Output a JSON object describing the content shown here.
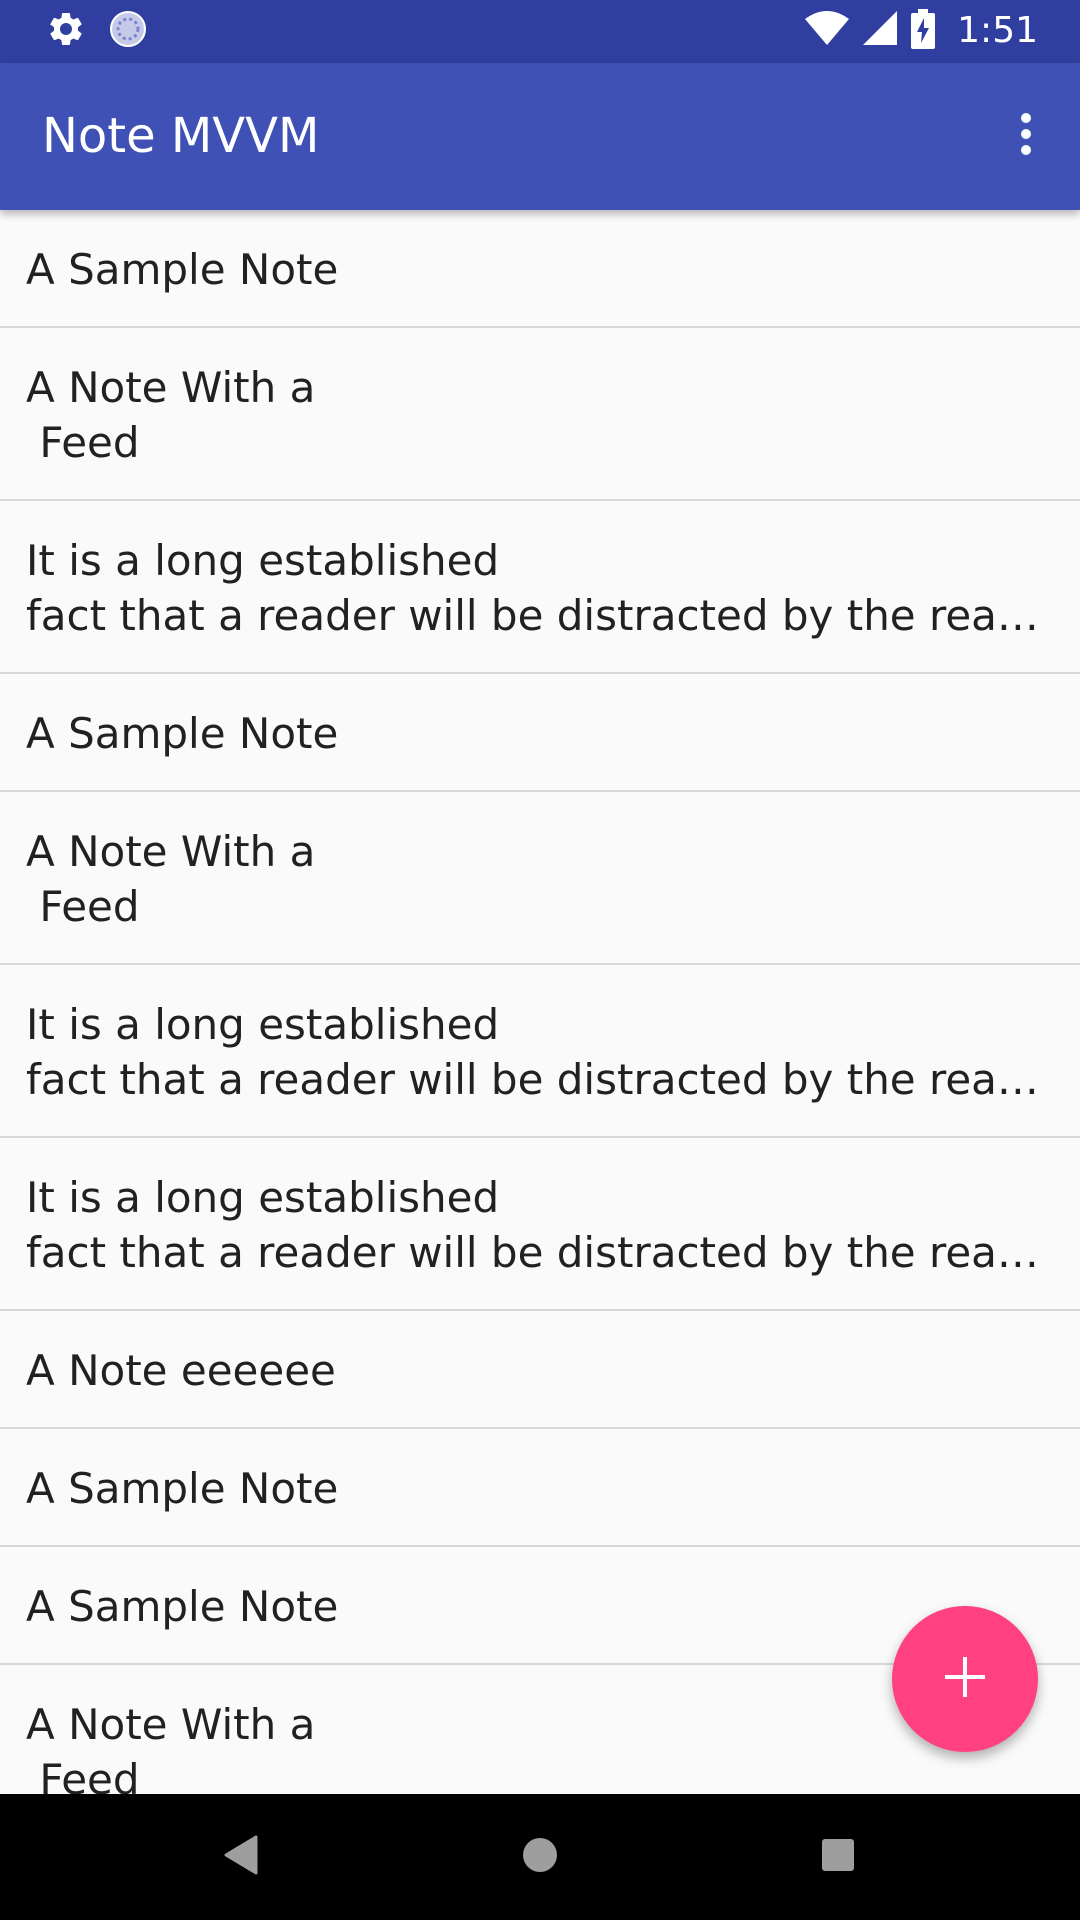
{
  "status_bar": {
    "time": "1:51",
    "left_icons": [
      "settings-icon",
      "sync-icon"
    ],
    "right_icons": [
      "wifi-icon",
      "cell-signal-icon",
      "battery-charging-icon"
    ]
  },
  "app_bar": {
    "title": "Note MVVM",
    "menu_icon": "more-vert-icon"
  },
  "notes": [
    {
      "text": "A Sample Note"
    },
    {
      "text": "A Note With a\n Feed"
    },
    {
      "text": "It is a long established\nfact that a reader will be distracted by the readable content"
    },
    {
      "text": "A Sample Note"
    },
    {
      "text": "A Note With a\n Feed"
    },
    {
      "text": "It is a long established\nfact that a reader will be distracted by the readable content"
    },
    {
      "text": "It is a long established\nfact that a reader will be distracted by the readable content"
    },
    {
      "text": "A Note eeeeee"
    },
    {
      "text": "A Sample Note"
    },
    {
      "text": "A Sample Note"
    },
    {
      "text": "A Note With a\n Feed"
    }
  ],
  "fab": {
    "icon": "add-icon"
  },
  "navigation_bar": {
    "buttons": [
      "back-icon",
      "home-icon",
      "recents-icon"
    ]
  },
  "colors": {
    "status_bar": "#303f9f",
    "app_bar": "#3f51b5",
    "fab": "#ff4081",
    "background": "#fafafa",
    "divider": "#d8d8d8"
  }
}
